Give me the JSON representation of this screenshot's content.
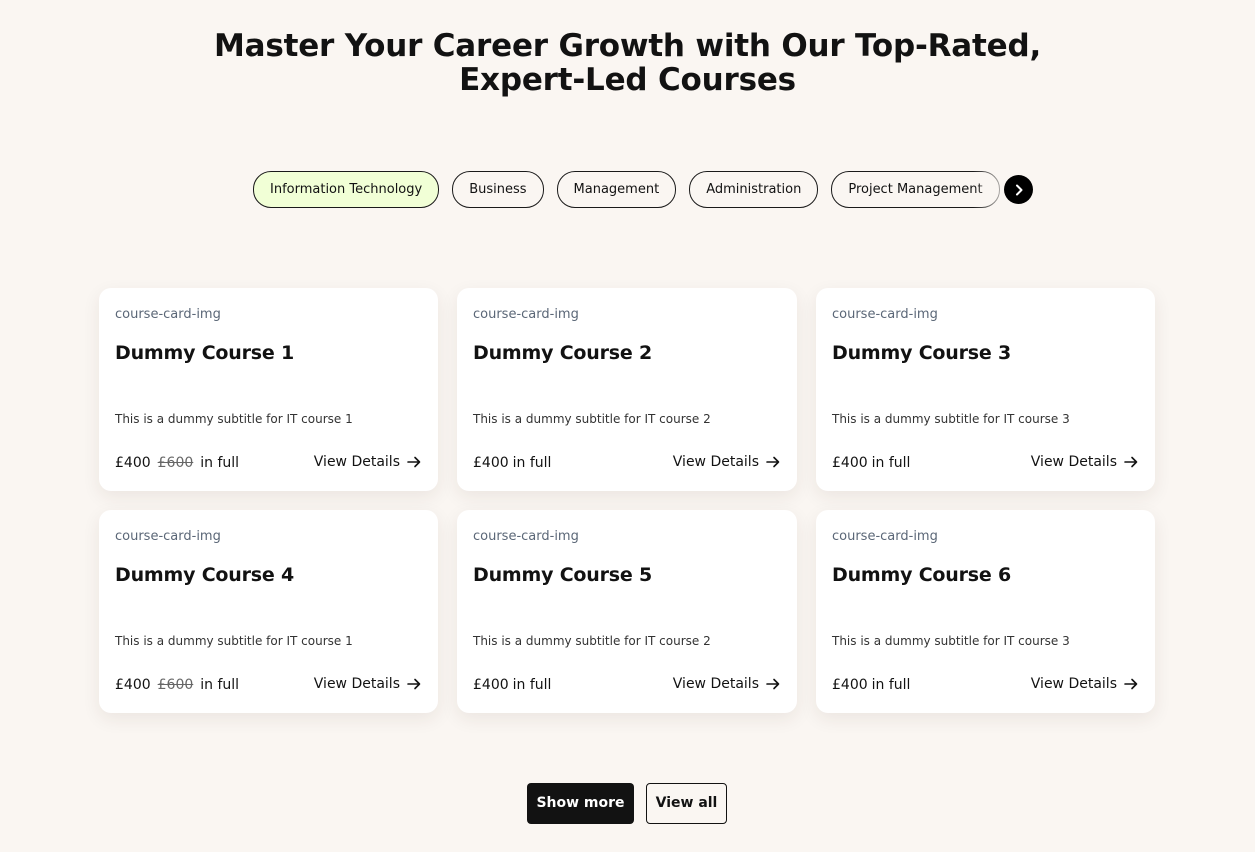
{
  "heading": {
    "line1": "Master Your Career Growth with Our Top-Rated,",
    "line2": "Expert-Led Courses"
  },
  "tabs": [
    {
      "label": "Information Technology",
      "active": true
    },
    {
      "label": "Business",
      "active": false
    },
    {
      "label": "Management",
      "active": false
    },
    {
      "label": "Administration",
      "active": false
    },
    {
      "label": "Project Management",
      "active": false
    },
    {
      "label": "",
      "active": false
    }
  ],
  "courses": [
    {
      "img_alt": "course-card-img",
      "title": "Dummy Course 1",
      "subtitle": "This is a dummy subtitle for IT course 1",
      "price": "£400",
      "old_price": "£600",
      "price_suffix": "in full",
      "link": "View Details"
    },
    {
      "img_alt": "course-card-img",
      "title": "Dummy Course 2",
      "subtitle": "This is a dummy subtitle for IT course 2",
      "price": "£400",
      "old_price": "",
      "price_suffix": "in full",
      "link": "View Details"
    },
    {
      "img_alt": "course-card-img",
      "title": "Dummy Course 3",
      "subtitle": "This is a dummy subtitle for IT course 3",
      "price": "£400",
      "old_price": "",
      "price_suffix": "in full",
      "link": "View Details"
    },
    {
      "img_alt": "course-card-img",
      "title": "Dummy Course 4",
      "subtitle": "This is a dummy subtitle for IT course 1",
      "price": "£400",
      "old_price": "£600",
      "price_suffix": "in full",
      "link": "View Details"
    },
    {
      "img_alt": "course-card-img",
      "title": "Dummy Course 5",
      "subtitle": "This is a dummy subtitle for IT course 2",
      "price": "£400",
      "old_price": "",
      "price_suffix": "in full",
      "link": "View Details"
    },
    {
      "img_alt": "course-card-img",
      "title": "Dummy Course 6",
      "subtitle": "This is a dummy subtitle for IT course 3",
      "price": "£400",
      "old_price": "",
      "price_suffix": "in full",
      "link": "View Details"
    }
  ],
  "buttons": {
    "show_more": "Show more",
    "view_all": "View all"
  },
  "icons": {
    "tabs_next": "chevron-right-icon",
    "card_link": "arrow-right-icon"
  },
  "colors": {
    "background": "#faf6f2",
    "active_tab": "#f1ffd6",
    "primary": "#121212"
  }
}
